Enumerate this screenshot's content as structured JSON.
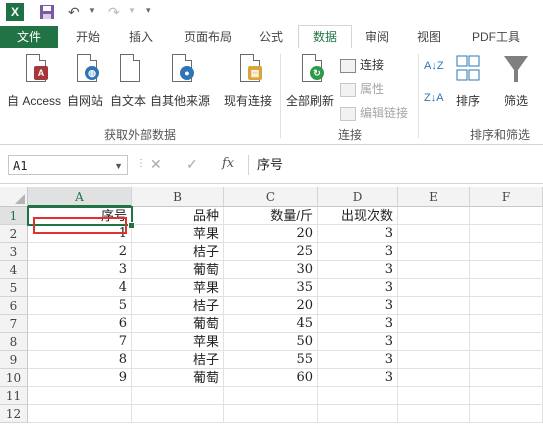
{
  "titlebar": {
    "app_icon": "X",
    "icons": [
      "save-icon",
      "undo-icon",
      "redo-icon"
    ]
  },
  "tabs": [
    {
      "label": "文件"
    },
    {
      "label": "开始"
    },
    {
      "label": "插入"
    },
    {
      "label": "页面布局"
    },
    {
      "label": "公式"
    },
    {
      "label": "数据"
    },
    {
      "label": "审阅"
    },
    {
      "label": "视图"
    },
    {
      "label": "PDF工具"
    }
  ],
  "ribbon": {
    "get_external": {
      "access": "自 Access",
      "web": "自网站",
      "text": "自文本",
      "other": "自其他来源",
      "existing": "现有连接",
      "group_label": "获取外部数据"
    },
    "connections": {
      "refresh_all": "全部刷新",
      "connections": "连接",
      "properties": "属性",
      "edit_links": "编辑链接",
      "group_label": "连接"
    },
    "sort_filter": {
      "sort": "排序",
      "filter": "筛选",
      "group_label": "排序和筛选"
    }
  },
  "formula_bar": {
    "name_box": "A1",
    "formula": "序号"
  },
  "columns": [
    "A",
    "B",
    "C",
    "D",
    "E",
    "F"
  ],
  "rows": [
    "1",
    "2",
    "3",
    "4",
    "5",
    "6",
    "7",
    "8",
    "9",
    "10",
    "11",
    "12"
  ],
  "table": {
    "headers": [
      "序号",
      "品种",
      "数量/斤",
      "出现次数"
    ],
    "rows": [
      [
        "1",
        "苹果",
        "20",
        "3"
      ],
      [
        "2",
        "桔子",
        "25",
        "3"
      ],
      [
        "3",
        "葡萄",
        "30",
        "3"
      ],
      [
        "4",
        "苹果",
        "35",
        "3"
      ],
      [
        "5",
        "桔子",
        "20",
        "3"
      ],
      [
        "6",
        "葡萄",
        "45",
        "3"
      ],
      [
        "7",
        "苹果",
        "50",
        "3"
      ],
      [
        "8",
        "桔子",
        "55",
        "3"
      ],
      [
        "9",
        "葡萄",
        "60",
        "3"
      ]
    ]
  },
  "colors": {
    "excel_green": "#217346",
    "highlight_red": "#e0302f"
  }
}
